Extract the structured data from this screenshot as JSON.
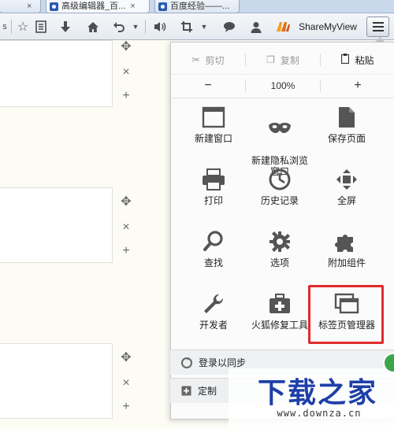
{
  "tabs": [
    {
      "title": "高级编辑器_百...",
      "close": "×"
    },
    {
      "title": "百度经验——...",
      "close": "×"
    }
  ],
  "toolbar": {
    "extension_label": "ShareMyView"
  },
  "edit": {
    "cut": "剪切",
    "copy": "复制",
    "paste": "粘贴"
  },
  "zoom": {
    "minus": "−",
    "level": "100%",
    "plus": "+"
  },
  "menu_items": [
    {
      "label": "新建窗口",
      "icon": "new-window-icon"
    },
    {
      "label": "新建隐私浏览\n窗口",
      "icon": "private-mask-icon"
    },
    {
      "label": "保存页面",
      "icon": "save-page-icon"
    },
    {
      "label": "打印",
      "icon": "printer-icon"
    },
    {
      "label": "历史记录",
      "icon": "history-clock-icon"
    },
    {
      "label": "全屏",
      "icon": "fullscreen-icon"
    },
    {
      "label": "查找",
      "icon": "magnifier-icon"
    },
    {
      "label": "选项",
      "icon": "gear-icon"
    },
    {
      "label": "附加组件",
      "icon": "puzzle-icon"
    },
    {
      "label": "开发者",
      "icon": "wrench-icon"
    },
    {
      "label": "火狐修复工具",
      "icon": "repair-kit-icon"
    },
    {
      "label": "标签页管理器",
      "icon": "tab-manager-icon"
    }
  ],
  "footer": {
    "sync": "登录以同步",
    "customize": "定制"
  },
  "watermark": {
    "title": "下载之家",
    "url": "www.downza.cn"
  },
  "colors": {
    "highlight": "#e12b2b",
    "watermark_blue": "#1e3fa8"
  }
}
